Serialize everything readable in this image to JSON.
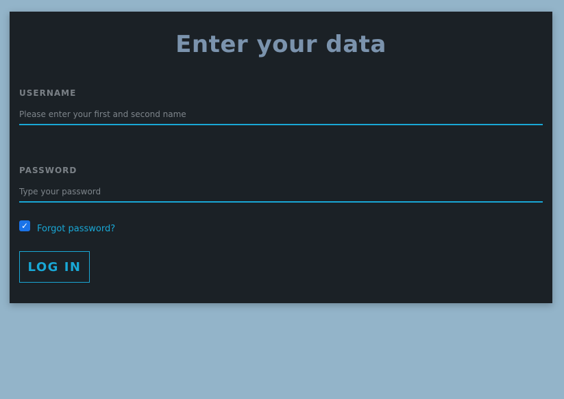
{
  "form": {
    "title": "Enter your data",
    "username": {
      "label": "USERNAME",
      "placeholder": "Please enter your first and second name",
      "value": ""
    },
    "password": {
      "label": "PASSWORD",
      "placeholder": "Type your password",
      "value": ""
    },
    "remember": {
      "checked": true,
      "link_label": "Forgot password?"
    },
    "login_label": "LOG IN"
  },
  "colors": {
    "background": "#93b4c9",
    "card": "#1b2126",
    "title": "#7b93ad",
    "accent": "#19a8d6",
    "checkbox": "#1a73e8"
  }
}
